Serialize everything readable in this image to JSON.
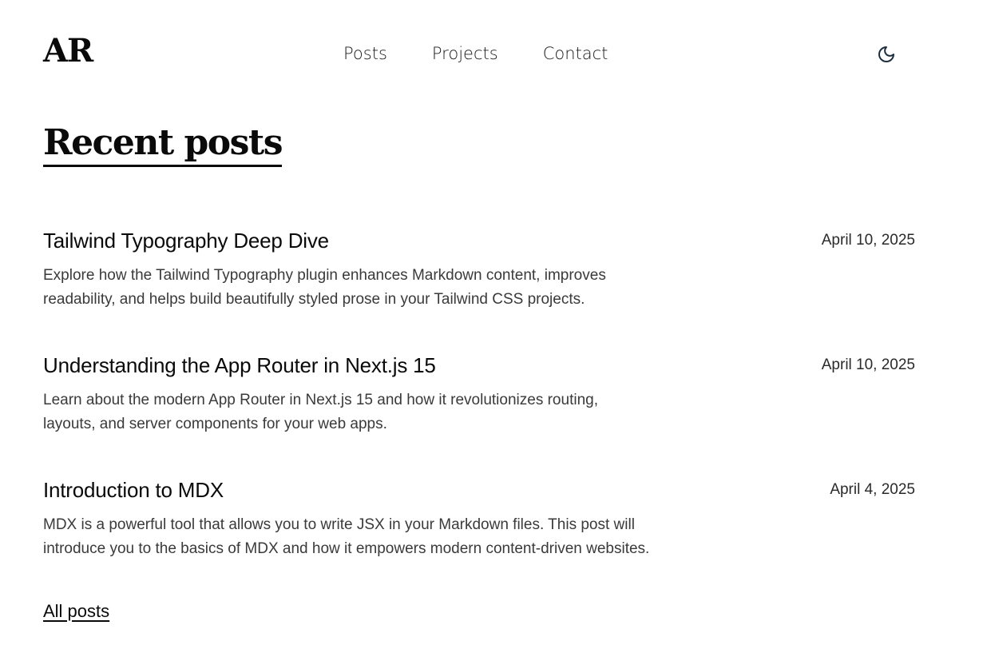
{
  "header": {
    "logo": "AR",
    "nav": [
      "Posts",
      "Projects",
      "Contact"
    ],
    "theme_toggle_icon": "moon-icon"
  },
  "main": {
    "title": "Recent posts",
    "posts": [
      {
        "title": "Tailwind Typography Deep Dive",
        "date": "April 10, 2025",
        "description": "Explore how the Tailwind Typography plugin enhances Markdown content, improves readability, and helps build beautifully styled prose in your Tailwind CSS projects."
      },
      {
        "title": "Understanding the App Router in Next.js 15",
        "date": "April 10, 2025",
        "description": "Learn about the modern App Router in Next.js 15 and how it revolutionizes routing, layouts, and server components for your web apps."
      },
      {
        "title": "Introduction to MDX",
        "date": "April 4, 2025",
        "description": "MDX is a powerful tool that allows you to write JSX in your Markdown files. This post will introduce you to the basics of MDX and how it empowers modern content-driven websites."
      }
    ],
    "all_posts_label": "All posts"
  },
  "colors": {
    "text": "#0a0a0a",
    "muted": "#3a3a3a",
    "icon": "#1f2f3f"
  }
}
